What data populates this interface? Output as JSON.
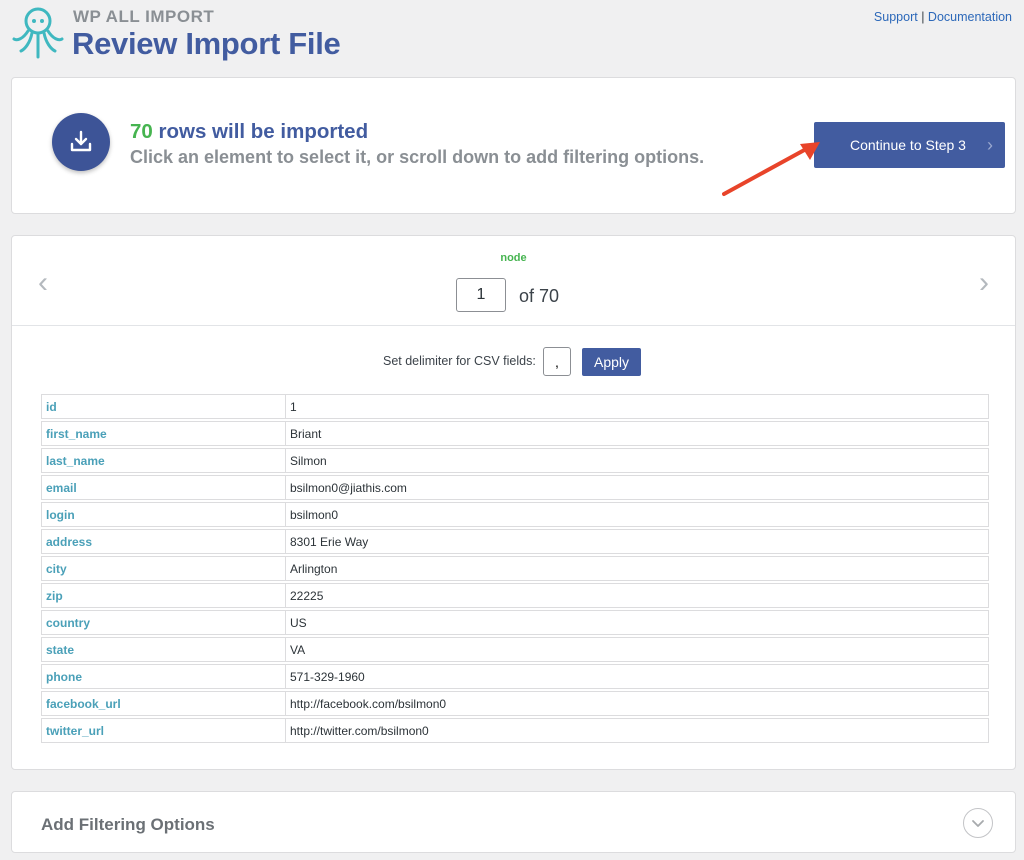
{
  "header": {
    "brand": "WP ALL IMPORT",
    "title": "Review Import File",
    "support_link": "Support",
    "separator": "|",
    "docs_link": "Documentation"
  },
  "status": {
    "count": "70",
    "count_suffix": "rows will be imported",
    "hint": "Click an element to select it, or scroll down to add filtering options.",
    "continue_label": "Continue to Step 3",
    "continue_chevron": "›"
  },
  "record": {
    "node_label": "node",
    "prev_arrow": "‹",
    "next_arrow": "›",
    "page_value": "1",
    "of_total": "of 70",
    "delimiter_label": "Set delimiter for CSV fields:",
    "delimiter_value": ",",
    "apply_label": "Apply",
    "rows": [
      {
        "key": "id",
        "value": "1"
      },
      {
        "key": "first_name",
        "value": "Briant"
      },
      {
        "key": "last_name",
        "value": "Silmon"
      },
      {
        "key": "email",
        "value": "bsilmon0@jiathis.com"
      },
      {
        "key": "login",
        "value": "bsilmon0"
      },
      {
        "key": "address",
        "value": "8301 Erie Way"
      },
      {
        "key": "city",
        "value": "Arlington"
      },
      {
        "key": "zip",
        "value": "22225"
      },
      {
        "key": "country",
        "value": "US"
      },
      {
        "key": "state",
        "value": "VA"
      },
      {
        "key": "phone",
        "value": "571-329-1960"
      },
      {
        "key": "facebook_url",
        "value": "http://facebook.com/bsilmon0"
      },
      {
        "key": "twitter_url",
        "value": "http://twitter.com/bsilmon0"
      }
    ]
  },
  "filter": {
    "title": "Add Filtering Options"
  },
  "colors": {
    "brand_blue": "#425ca0",
    "accent_green": "#46b450",
    "key_teal": "#4aa0b8",
    "arrow_red": "#e8442a"
  },
  "icons": {
    "logo": "octopus-logo-icon",
    "import": "download-tray-icon",
    "toggle": "chevron-down-icon"
  }
}
